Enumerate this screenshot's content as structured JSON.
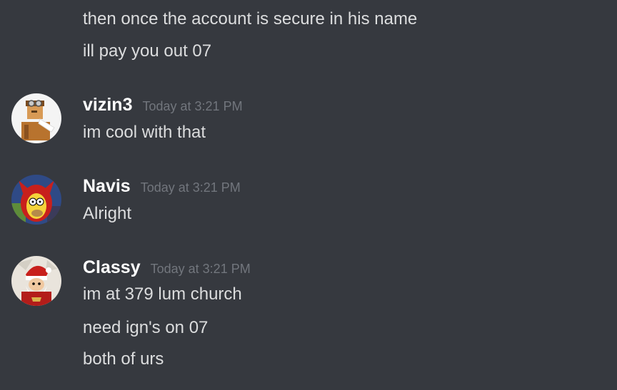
{
  "messages": {
    "continued": [
      {
        "text": "then once the account is secure in his name"
      },
      {
        "text": "ill pay you out 07"
      }
    ],
    "groups": [
      {
        "author": "vizin3",
        "timestamp": "Today at 3:21 PM",
        "avatar_icon": "aviator-avatar-icon",
        "lines": [
          "im cool with that"
        ]
      },
      {
        "author": "Navis",
        "timestamp": "Today at 3:21 PM",
        "avatar_icon": "devil-homer-avatar-icon",
        "lines": [
          "Alright"
        ]
      },
      {
        "author": "Classy",
        "timestamp": "Today at 3:21 PM",
        "avatar_icon": "santa-avatar-icon",
        "lines": [
          "im at 379 lum church",
          "need ign's on 07",
          "both of urs"
        ]
      }
    ]
  },
  "colors": {
    "background": "#36393f",
    "message_text": "#dcddde",
    "username": "#ffffff",
    "timestamp": "#72767d"
  }
}
